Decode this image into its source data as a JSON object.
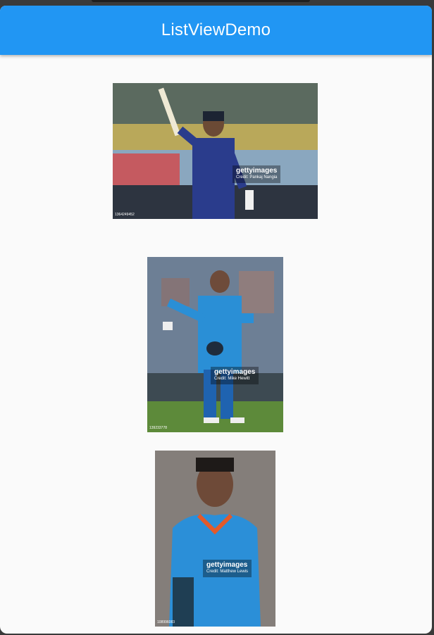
{
  "app": {
    "title": "ListViewDemo"
  },
  "items": [
    {
      "alt": "Cricketer raising bat",
      "watermark": "gettyimages",
      "credit": "Credit: Pankaj Nangia",
      "id_text": "1364249452"
    },
    {
      "alt": "Cricketer in India kit holding helmet",
      "watermark": "gettyimages",
      "credit": "Credit: Mike Hewitt",
      "id_text": "139233778"
    },
    {
      "alt": "Cricketer portrait in blue kit",
      "watermark": "gettyimages",
      "credit": "Credit: Matthew Lewis",
      "id_text": "108996083"
    }
  ],
  "colors": {
    "appbar": "#2196f3",
    "background": "#fafafa"
  }
}
